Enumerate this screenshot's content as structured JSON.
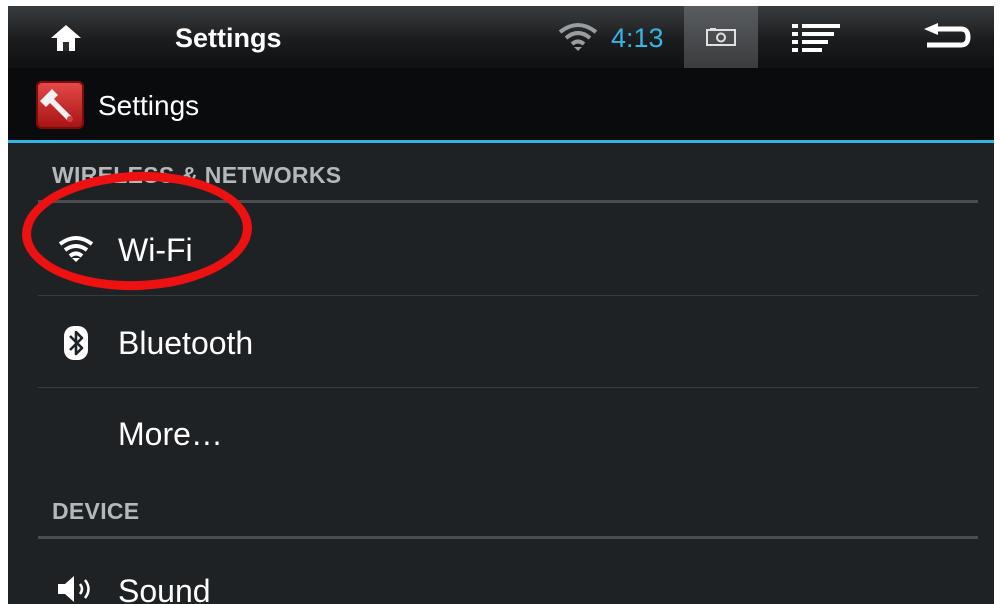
{
  "system_bar": {
    "title": "Settings",
    "clock": "4:13",
    "icons": [
      "home-icon",
      "wifi-signal-icon",
      "screenshot-icon",
      "menu-icon",
      "back-icon"
    ],
    "accent_color": "#33b5e5"
  },
  "action_bar": {
    "app_icon": "settings-wrench-icon",
    "title": "Settings",
    "accent_color": "#33b5e5"
  },
  "sections": [
    {
      "header": "WIRELESS & NETWORKS",
      "items": [
        {
          "label": "Wi-Fi",
          "icon": "wifi-icon",
          "highlighted": true
        },
        {
          "label": "Bluetooth",
          "icon": "bluetooth-icon"
        },
        {
          "label": "More…",
          "icon": ""
        }
      ]
    },
    {
      "header": "DEVICE",
      "items": [
        {
          "label": "Sound",
          "icon": "speaker-icon"
        }
      ]
    }
  ],
  "annotation": {
    "ring_color": "#ee1111"
  }
}
